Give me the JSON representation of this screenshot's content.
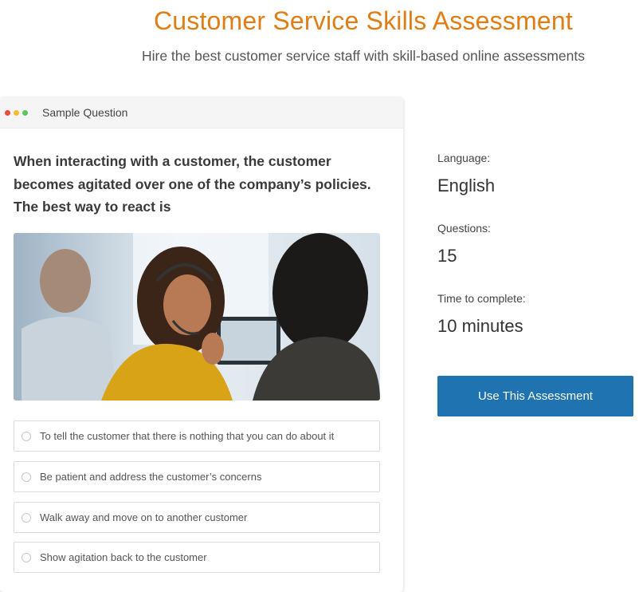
{
  "header": {
    "title": "Customer Service Skills Assessment",
    "subtitle": "Hire the best customer service staff with skill-based online assessments"
  },
  "card": {
    "label": "Sample Question",
    "question": "When interacting with a customer, the customer becomes agitated over one of the company’s policies. The best way to react is",
    "options": [
      "To tell the customer that there is nothing that you can do about it",
      "Be patient and address the customer’s concerns",
      "Walk away and move on to another customer",
      "Show agitation back to the customer"
    ]
  },
  "details": {
    "language_label": "Language:",
    "language_value": "English",
    "questions_label": "Questions:",
    "questions_value": "15",
    "time_label": "Time to complete:",
    "time_value": "10 minutes"
  },
  "cta": {
    "label": "Use This Assessment"
  },
  "colors": {
    "title": "#e07d14",
    "button": "#1e73b0"
  }
}
